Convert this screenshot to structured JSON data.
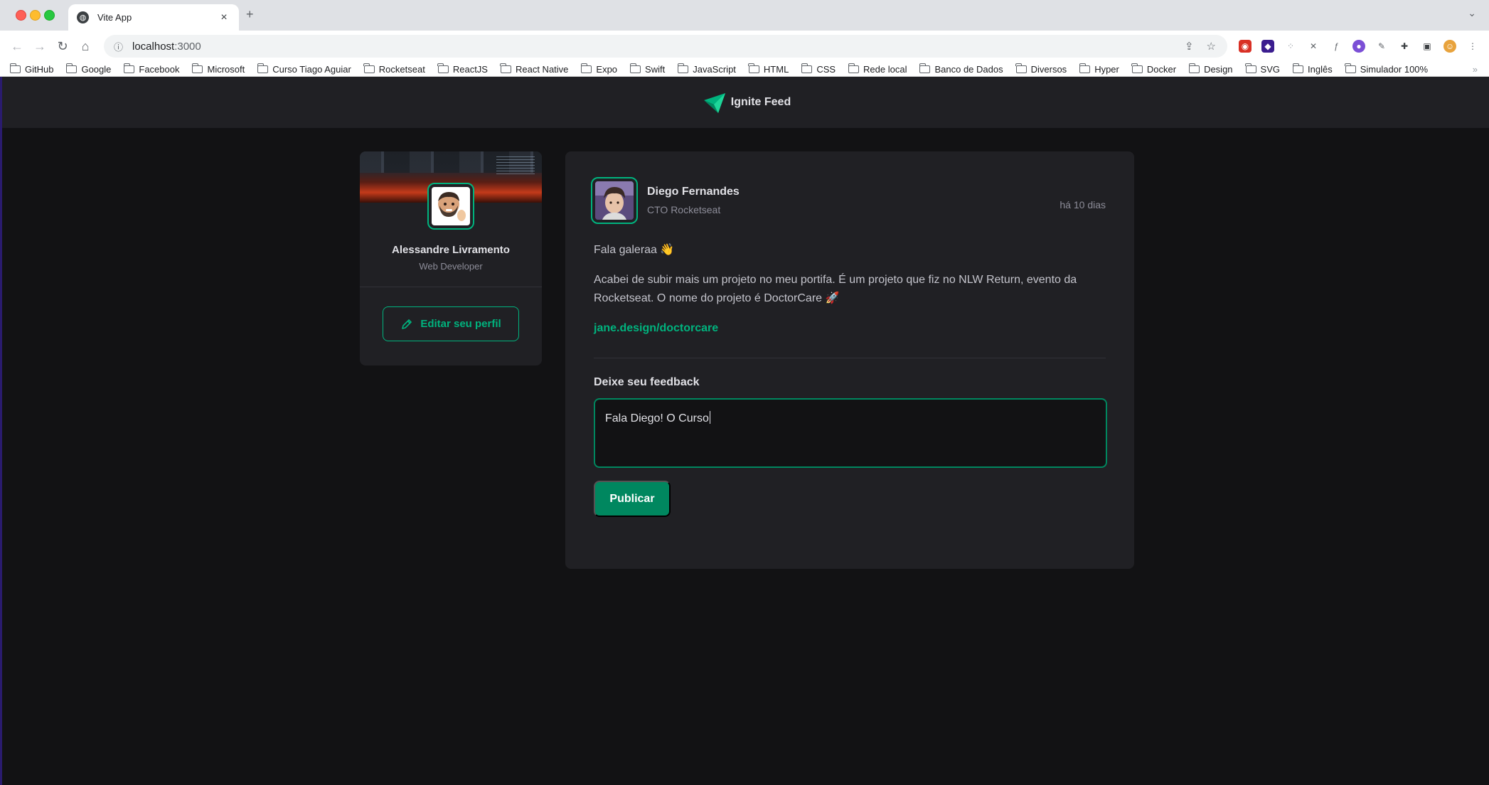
{
  "browser": {
    "tab_title": "Vite App",
    "tab_close": "×",
    "new_tab": "+",
    "url_host": "localhost",
    "url_port": ":3000",
    "bookmarks": [
      "GitHub",
      "Google",
      "Facebook",
      "Microsoft",
      "Curso Tiago Aguiar",
      "Rocketseat",
      "ReactJS",
      "React Native",
      "Expo",
      "Swift",
      "JavaScript",
      "HTML",
      "CSS",
      "Rede local",
      "Banco de Dados",
      "Diversos",
      "Hyper",
      "Docker",
      "Design",
      "SVG",
      "Inglês",
      "Simulador 100%"
    ],
    "bookmarks_more": "»"
  },
  "header": {
    "title": "Ignite Feed"
  },
  "profile": {
    "name": "Alessandre Livramento",
    "role": "Web Developer",
    "edit_label": "Editar seu perfil"
  },
  "post": {
    "author_name": "Diego Fernandes",
    "author_role": "CTO Rocketseat",
    "time": "há 10 dias",
    "greeting": "Fala galeraa 👋",
    "body": "Acabei de subir mais um projeto no meu portifa. É um projeto que fiz no NLW Return, evento da Rocketseat. O nome do projeto é DoctorCare 🚀",
    "link": "jane.design/doctorcare",
    "feedback_title": "Deixe seu feedback",
    "feedback_value": "Fala Diego! O Curso",
    "publish_label": "Publicar"
  },
  "colors": {
    "accent": "#00b37e",
    "accent_dark": "#00875f",
    "background": "#121214",
    "card": "#202024"
  }
}
